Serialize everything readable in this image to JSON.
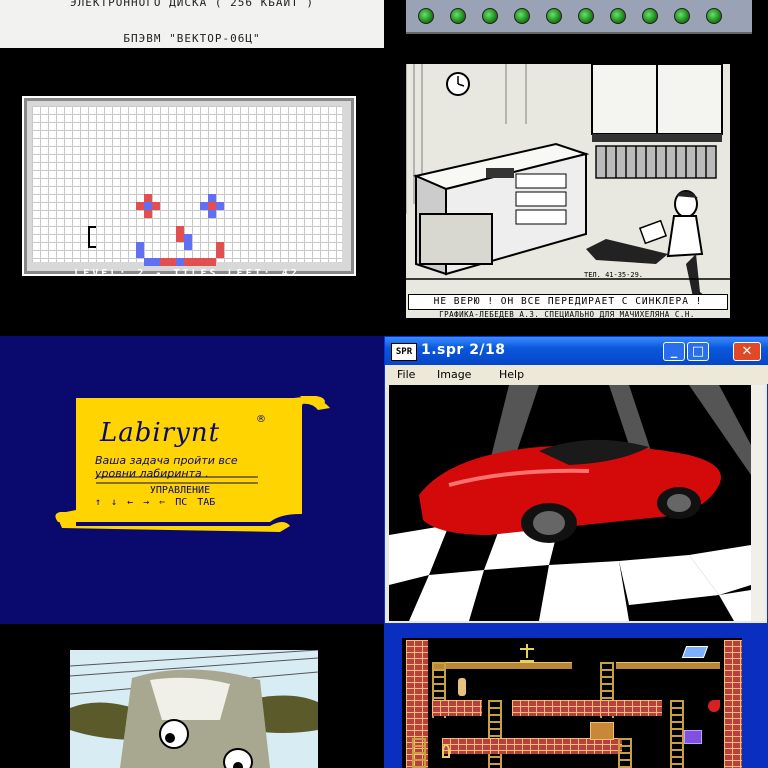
{
  "document": {
    "line1": "ЭЛЕКТРОННОГО ДИСКА ( 256 КБАЙТ )",
    "line2": "БПЭВМ \"ВЕКТОР-06Ц\""
  },
  "tiles_game": {
    "status": "LEVEL: 2  -  TILES LEFT: 42",
    "colors": {
      "red": "#e05050",
      "blue": "#6070f0",
      "grid": "#c8c8c8"
    }
  },
  "comic": {
    "phone": "ТЕЛ. 41-35-29.",
    "caption": "НЕ ВЕРЮ ! ОН ВСЕ ПЕРЕДИРАЕТ С СИНКЛЕРА !",
    "credit": "ГРАФИКА-ЛЕБЕДЕВ А.З.  СПЕЦИАЛЬНО ДЛЯ МАЧИХЕЛЯНА С.Н."
  },
  "labirynt": {
    "title": "Labirynt",
    "mark": "®",
    "line1": "Ваша задача пройти все",
    "line2": "уровни лабиринта .",
    "controls_label": "УПРАВЛЕНИЕ",
    "keys": "↑  ↓  ←  →  ⇐  ПС  ТАБ",
    "colors": {
      "scroll": "#ffd400",
      "background": "#0a0a6e"
    }
  },
  "window": {
    "app_icon": "SPR",
    "title": "1.spr    2/18",
    "menu": [
      "File",
      "Image",
      "Help"
    ],
    "buttons": {
      "minimize": "_",
      "maximize": "□",
      "close": "✕"
    }
  },
  "platform_game": {
    "colors": {
      "frame": "#0a2ec0",
      "brick": "#b84040",
      "ladder": "#c8a040"
    }
  }
}
